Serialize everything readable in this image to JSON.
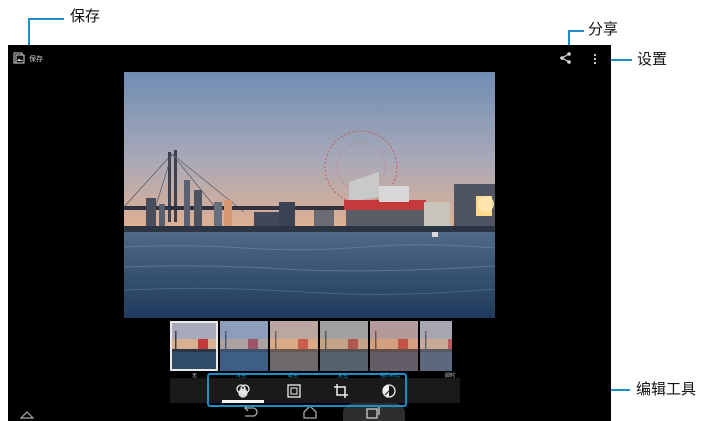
{
  "callouts": {
    "save": "保存",
    "share": "分享",
    "settings": "设置",
    "edit_tools": "编辑工具"
  },
  "action_bar": {
    "save_label": "保存"
  },
  "filters": [
    {
      "label": "无",
      "selected": true
    },
    {
      "label": "冷色"
    },
    {
      "label": "暖色"
    },
    {
      "label": "复古"
    },
    {
      "label": "强烈对比"
    },
    {
      "label": "即时"
    }
  ],
  "toolbar": {
    "tools": [
      "filters-icon",
      "frame-icon",
      "crop-icon",
      "adjust-icon"
    ],
    "active": "filters-icon"
  },
  "nav": {
    "icons": [
      "up-arrow-icon",
      "back-icon",
      "home-icon",
      "recent-apps-icon"
    ]
  },
  "colors": {
    "callout_blue": "#1e8ec8",
    "holo_blue": "#33b5e5"
  }
}
